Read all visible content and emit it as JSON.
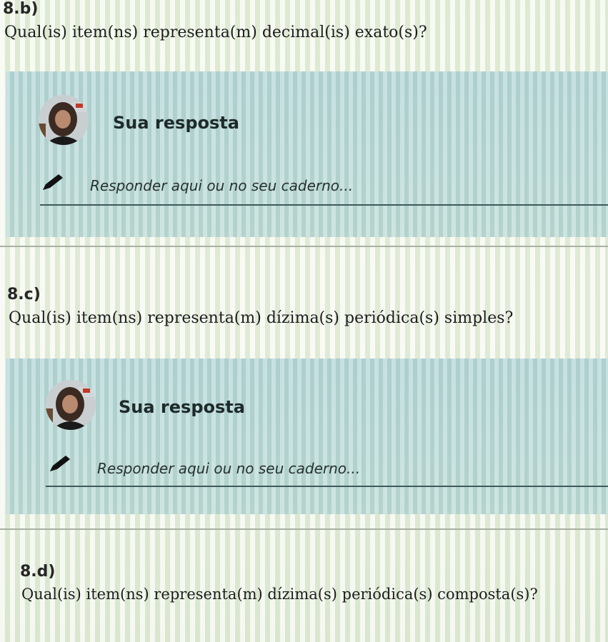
{
  "questions": [
    {
      "label": "8.b)",
      "text": "Qual(is) item(ns) representa(m) decimal(is) exato(s)?",
      "response_title": "Sua resposta",
      "answer_placeholder": "Responder aqui ou no seu caderno..."
    },
    {
      "label": "8.c)",
      "text": "Qual(is) item(ns) representa(m) dízima(s) periódica(s) simples?",
      "response_title": "Sua resposta",
      "answer_placeholder": "Responder aqui ou no seu caderno..."
    },
    {
      "label": "8.d)",
      "text": "Qual(is) item(ns) representa(m) dízima(s) periódica(s) composta(s)?"
    }
  ],
  "colors": {
    "card_background": "#bcd9d8",
    "underline": "#3e5a5d",
    "page_background": "#eef3e6"
  },
  "icons": {
    "avatar": "user-avatar-photo",
    "pencil": "pencil-icon"
  }
}
